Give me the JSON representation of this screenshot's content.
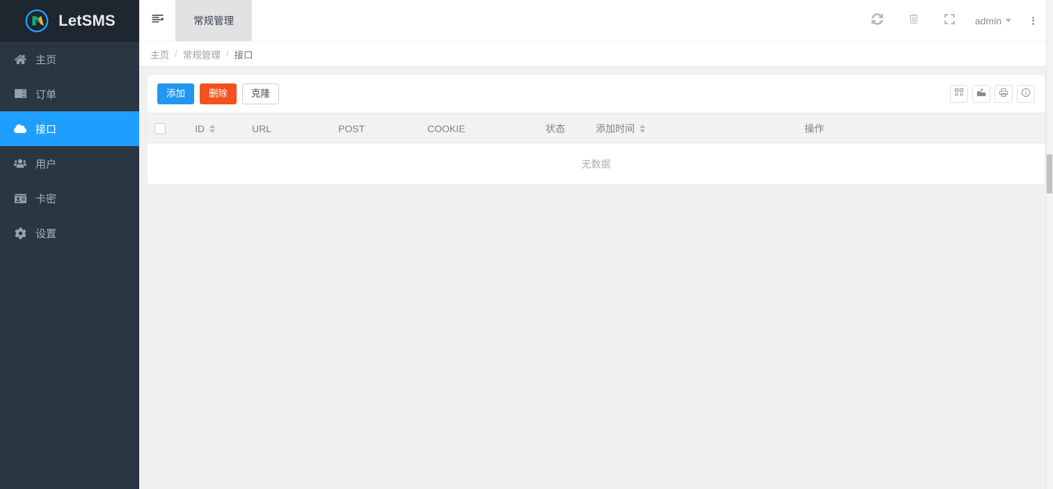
{
  "brand": {
    "name": "LetSMS",
    "logo_icon": "letsms-logo-icon",
    "logo_circle_color": "#1E9FFF",
    "logo_n_color": "#1BA37E",
    "logo_slash_color": "#F2B033"
  },
  "sidebar": {
    "items": [
      {
        "label": "主页",
        "icon": "home-icon",
        "active": false
      },
      {
        "label": "订单",
        "icon": "server-icon",
        "active": false
      },
      {
        "label": "接口",
        "icon": "cloud-icon",
        "active": true
      },
      {
        "label": "用户",
        "icon": "users-icon",
        "active": false
      },
      {
        "label": "卡密",
        "icon": "id-card-icon",
        "active": false
      },
      {
        "label": "设置",
        "icon": "gear-icon",
        "active": false
      }
    ],
    "bg_color": "#2b3643",
    "active_color": "#1E9FFF"
  },
  "topbar": {
    "collapse_icon": "sidebar-collapse-icon",
    "tabs": [
      {
        "label": "常规管理",
        "active": true
      }
    ],
    "icons": [
      {
        "name": "refresh-icon"
      },
      {
        "name": "trash-icon"
      },
      {
        "name": "fullscreen-icon"
      }
    ],
    "user": {
      "name": "admin",
      "caret_icon": "chevron-down-icon"
    },
    "more_icon": "more-vertical-icon"
  },
  "breadcrumb": {
    "items": [
      "主页",
      "常规管理",
      "接口"
    ],
    "separator": "/"
  },
  "toolbar": {
    "add_label": "添加",
    "delete_label": "删除",
    "clone_label": "克隆",
    "icons": [
      {
        "name": "columns-icon"
      },
      {
        "name": "export-icon"
      },
      {
        "name": "print-icon"
      },
      {
        "name": "info-icon"
      }
    ]
  },
  "table": {
    "select_all_checkbox": "",
    "columns": [
      {
        "label": "ID",
        "sortable": true
      },
      {
        "label": "URL",
        "sortable": false
      },
      {
        "label": "POST",
        "sortable": false
      },
      {
        "label": "COOKIE",
        "sortable": false
      },
      {
        "label": "状态",
        "sortable": false
      },
      {
        "label": "添加时间",
        "sortable": true
      },
      {
        "label": "操作",
        "sortable": false
      }
    ],
    "rows": [],
    "empty_text": "无数据"
  }
}
